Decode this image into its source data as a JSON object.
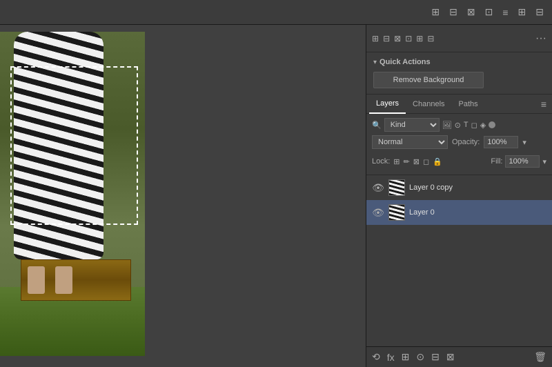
{
  "toolbar": {
    "icons": [
      "⊞",
      "⊟",
      "⊠",
      "⊡",
      "≡",
      "⊞",
      "⊟"
    ]
  },
  "panel_top": {
    "icons": [
      "⊞",
      "⊟",
      "⊠",
      "⊡",
      "⊞",
      "⊟"
    ],
    "dots": "···"
  },
  "quick_actions": {
    "title": "Quick Actions",
    "chevron": "▾",
    "remove_background_label": "Remove Background"
  },
  "layers": {
    "tabs": [
      {
        "label": "Layers",
        "active": true
      },
      {
        "label": "Channels",
        "active": false
      },
      {
        "label": "Paths",
        "active": false
      }
    ],
    "kind_label": "Kind",
    "blend_mode": "Normal",
    "opacity_label": "Opacity:",
    "opacity_value": "100%",
    "lock_label": "Lock:",
    "fill_label": "Fill:",
    "fill_value": "100%",
    "items": [
      {
        "name": "Layer 0 copy",
        "visible": true,
        "selected": false
      },
      {
        "name": "Layer 0",
        "visible": true,
        "selected": true
      }
    ]
  },
  "bottom_bar": {
    "icons": [
      "⟲",
      "fx",
      "⊞",
      "⊙",
      "⊟",
      "⊠",
      "🗑"
    ]
  }
}
